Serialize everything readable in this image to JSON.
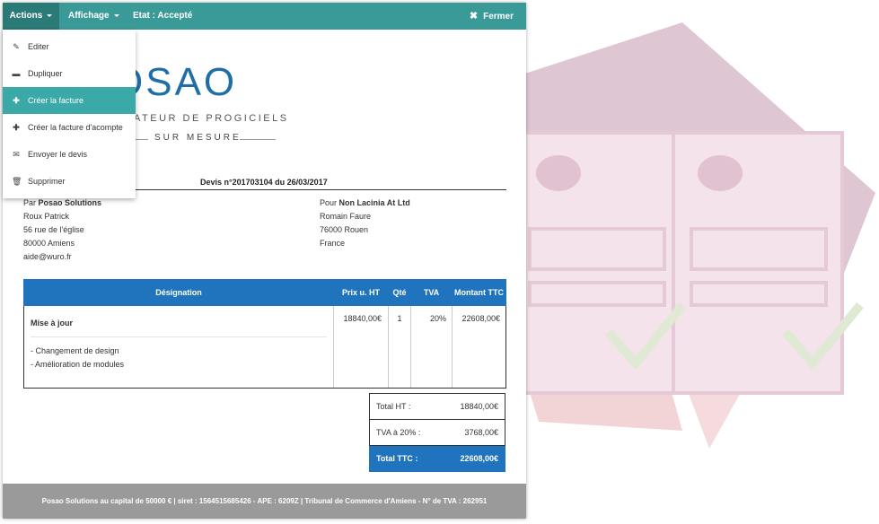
{
  "toolbar": {
    "actions_label": "Actions",
    "affichage_label": "Affichage",
    "etat_label": "Etat : Accepté",
    "fermer_label": "Fermer"
  },
  "actions_menu": [
    {
      "label": "Editer",
      "icon": "pencil-icon"
    },
    {
      "label": "Dupliquer",
      "icon": "duplicate-icon"
    },
    {
      "label": "Créer la facture",
      "icon": "plus-icon",
      "active": true
    },
    {
      "label": "Créer la facture d'acompte",
      "icon": "plus-icon"
    },
    {
      "label": "Envoyer le devis",
      "icon": "envelope-icon"
    },
    {
      "label": "Supprimer",
      "icon": "trash-icon"
    }
  ],
  "logo": {
    "brand_text": "OSAO",
    "tagline": "ATEUR DE PROGICIELS",
    "tagline2": "SUR MESURE"
  },
  "document": {
    "title": "Devis n°201703104 du 26/03/2017",
    "from": {
      "prefix": "Par",
      "company": "Posao Solutions",
      "lines": [
        "Roux Patrick",
        "56 rue de l'église",
        "80000 Amiens",
        "aide@wuro.fr"
      ]
    },
    "to": {
      "prefix": "Pour",
      "company": "Non Lacinia At Ltd",
      "lines": [
        "Romain Faure",
        "76000 Rouen",
        "France"
      ]
    },
    "table": {
      "headers": [
        "Désignation",
        "Prix u. HT",
        "Qté",
        "TVA",
        "Montant TTC"
      ],
      "rows": [
        {
          "title": "Mise à jour",
          "details": [
            "- Changement de design",
            "- Amélioration de modules"
          ],
          "price": "18840,00€",
          "qty": "1",
          "tva": "20%",
          "amount": "22608,00€"
        }
      ]
    },
    "totals": {
      "ht_label": "Total HT :",
      "ht_value": "18840,00€",
      "tva_label": "TVA à 20% :",
      "tva_value": "3768,00€",
      "ttc_label": "Total TTC :",
      "ttc_value": "22608,00€"
    },
    "footer": "Posao Solutions au capital de 50000 € | siret : 1564515685426 - APE : 6209Z | Tribunal de Commerce d'Amiens - N° de TVA : 262951"
  },
  "colors": {
    "toolbar": "#3a9a97",
    "toolbar_active": "#2a7a78",
    "menu_active": "#3aa9a7",
    "table_header": "#1f74bd",
    "footer": "#9a9a9a",
    "logo": "#1e6fa8"
  }
}
